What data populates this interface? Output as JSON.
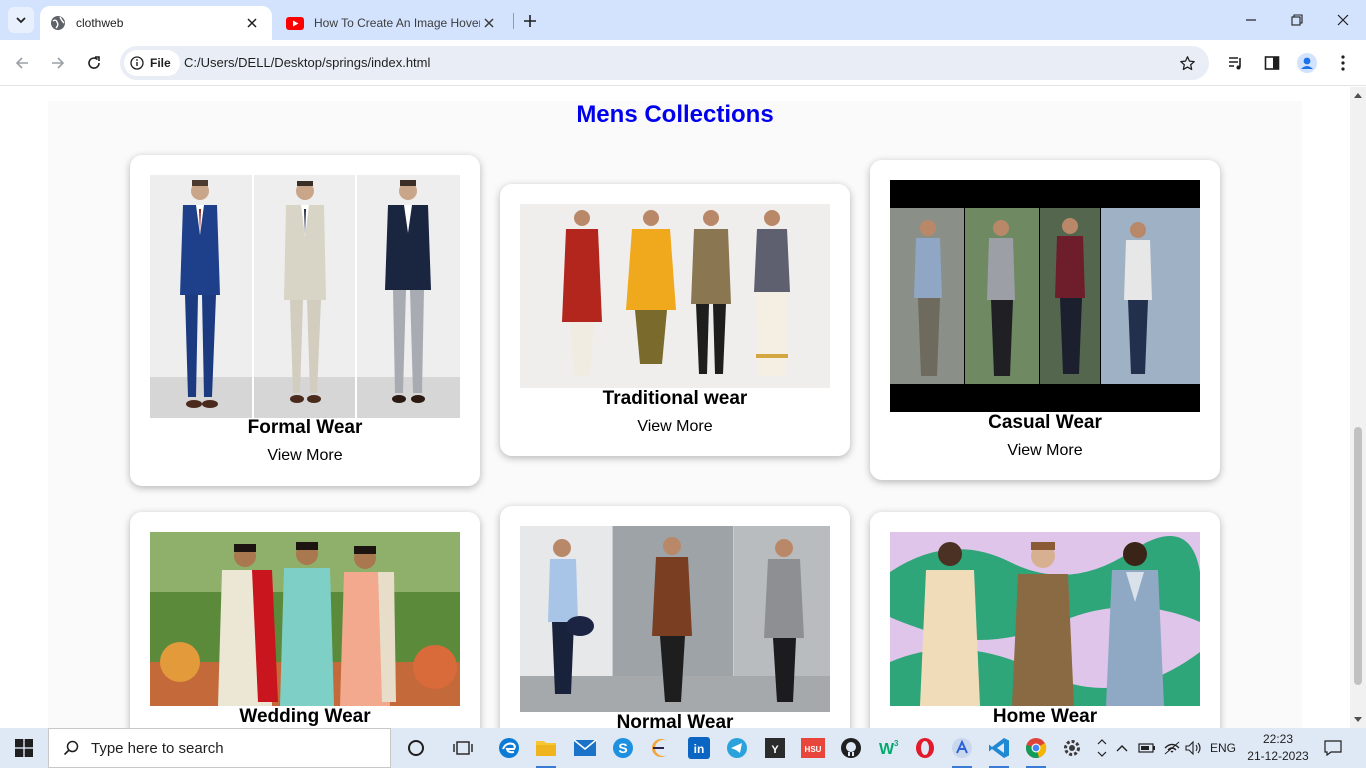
{
  "browser": {
    "tabs": [
      {
        "title": "clothweb",
        "icon": "globe-icon",
        "active": true
      },
      {
        "title": "How To Create An Image Hover",
        "icon": "youtube-icon",
        "active": false
      }
    ],
    "address_chip": "File",
    "url": "C:/Users/DELL/Desktop/springs/index.html"
  },
  "page": {
    "heading": "Mens Collections",
    "heading_color": "#0000ee",
    "cards": [
      {
        "name": "Formal Wear",
        "link": "View More",
        "image": "formal-wear-photo"
      },
      {
        "name": "Traditional wear",
        "link": "View More",
        "image": "traditional-wear-photo"
      },
      {
        "name": "Casual Wear",
        "link": "View More",
        "image": "casual-wear-photo"
      },
      {
        "name": "Wedding Wear",
        "image": "wedding-wear-photo"
      },
      {
        "name": "Normal Wear",
        "image": "normal-wear-photo"
      },
      {
        "name": "Home Wear",
        "image": "home-wear-photo"
      }
    ]
  },
  "taskbar": {
    "search_placeholder": "Type here to search",
    "language": "ENG",
    "time": "22:23",
    "date": "21-12-2023",
    "apps": [
      "cortana-icon",
      "task-view-icon",
      "edge-icon",
      "file-explorer-icon",
      "mail-icon",
      "skype-icon",
      "eclipse-icon",
      "linkedin-icon",
      "telegram-icon",
      "y-app-icon",
      "hsu-app-icon",
      "github-icon",
      "w3schools-icon",
      "opera-icon",
      "app-store-icon",
      "vscode-icon",
      "chrome-icon",
      "settings-icon"
    ]
  }
}
